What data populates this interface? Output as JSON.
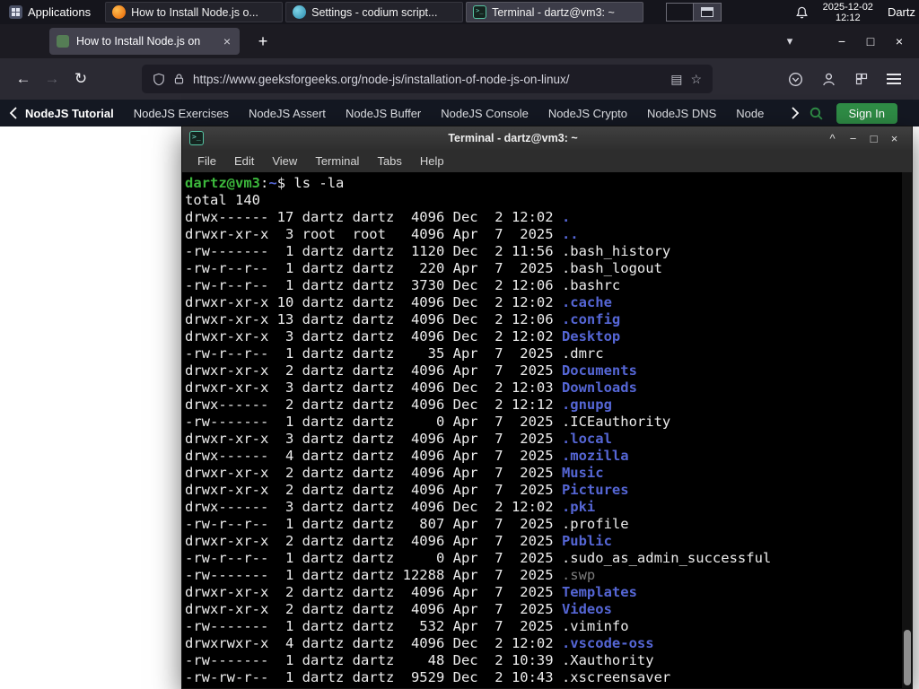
{
  "colors": {
    "gfg_green": "#2f8d46",
    "terminal_dir_blue": "#5566d5",
    "terminal_prompt_green": "#3cb83c",
    "terminal_dim": "#7d7d7d",
    "panel_bg": "#15151c",
    "firefox_toolbar": "#2b2a33"
  },
  "icons": {
    "back": "←",
    "forward": "→",
    "reload": "↻",
    "reader": "▤",
    "bookmark": "☆",
    "tab_list": "▾",
    "new_tab": "+",
    "tab_close": "×",
    "minimize": "−",
    "maximize": "□",
    "close": "×",
    "shade": "^"
  },
  "panel": {
    "applications_label": "Applications",
    "tasks": [
      {
        "label": "How to Install Node.js o...",
        "icon": "firefox",
        "cls": ""
      },
      {
        "label": "Settings - codium script...",
        "icon": "codium",
        "cls": ""
      },
      {
        "label": "Terminal - dartz@vm3: ~",
        "icon": "terminal",
        "cls": "active"
      }
    ],
    "clock_date": "2025-12-02",
    "clock_time": "12:12",
    "user_label": "Dartz"
  },
  "browser": {
    "tab_title": "How to Install Node.js on",
    "url": "https://www.geeksforgeeks.org/node-js/installation-of-node-js-on-linux/"
  },
  "site_nav": {
    "items": [
      {
        "label": "NodeJS Tutorial",
        "cls": "active"
      },
      {
        "label": "NodeJS Exercises",
        "cls": ""
      },
      {
        "label": "NodeJS Assert",
        "cls": ""
      },
      {
        "label": "NodeJS Buffer",
        "cls": ""
      },
      {
        "label": "NodeJS Console",
        "cls": ""
      },
      {
        "label": "NodeJS Crypto",
        "cls": ""
      },
      {
        "label": "NodeJS DNS",
        "cls": ""
      },
      {
        "label": "Node",
        "cls": ""
      }
    ],
    "signin_label": "Sign In"
  },
  "terminal": {
    "title": "Terminal - dartz@vm3: ~",
    "menu": [
      {
        "label": "File"
      },
      {
        "label": "Edit"
      },
      {
        "label": "View"
      },
      {
        "label": "Terminal"
      },
      {
        "label": "Tabs"
      },
      {
        "label": "Help"
      }
    ],
    "prompt": {
      "user_host": "dartz@vm3",
      "colon": ":",
      "path": "~",
      "dollar": "$",
      "command": " ls -la"
    },
    "total_line": "total 140",
    "lines": [
      {
        "pre": "drwx------ 17 dartz dartz  4096 Dec  2 12:02 ",
        "name": ".",
        "cls": "dir"
      },
      {
        "pre": "drwxr-xr-x  3 root  root   4096 Apr  7  2025 ",
        "name": "..",
        "cls": "dir"
      },
      {
        "pre": "-rw-------  1 dartz dartz  1120 Dec  2 11:56 ",
        "name": ".bash_history",
        "cls": "plain"
      },
      {
        "pre": "-rw-r--r--  1 dartz dartz   220 Apr  7  2025 ",
        "name": ".bash_logout",
        "cls": "plain"
      },
      {
        "pre": "-rw-r--r--  1 dartz dartz  3730 Dec  2 12:06 ",
        "name": ".bashrc",
        "cls": "plain"
      },
      {
        "pre": "drwxr-xr-x 10 dartz dartz  4096 Dec  2 12:02 ",
        "name": ".cache",
        "cls": "dir"
      },
      {
        "pre": "drwxr-xr-x 13 dartz dartz  4096 Dec  2 12:06 ",
        "name": ".config",
        "cls": "dir"
      },
      {
        "pre": "drwxr-xr-x  3 dartz dartz  4096 Dec  2 12:02 ",
        "name": "Desktop",
        "cls": "dir"
      },
      {
        "pre": "-rw-r--r--  1 dartz dartz    35 Apr  7  2025 ",
        "name": ".dmrc",
        "cls": "plain"
      },
      {
        "pre": "drwxr-xr-x  2 dartz dartz  4096 Apr  7  2025 ",
        "name": "Documents",
        "cls": "dir"
      },
      {
        "pre": "drwxr-xr-x  3 dartz dartz  4096 Dec  2 12:03 ",
        "name": "Downloads",
        "cls": "dir"
      },
      {
        "pre": "drwx------  2 dartz dartz  4096 Dec  2 12:12 ",
        "name": ".gnupg",
        "cls": "dir"
      },
      {
        "pre": "-rw-------  1 dartz dartz     0 Apr  7  2025 ",
        "name": ".ICEauthority",
        "cls": "plain"
      },
      {
        "pre": "drwxr-xr-x  3 dartz dartz  4096 Apr  7  2025 ",
        "name": ".local",
        "cls": "dir"
      },
      {
        "pre": "drwx------  4 dartz dartz  4096 Apr  7  2025 ",
        "name": ".mozilla",
        "cls": "dir"
      },
      {
        "pre": "drwxr-xr-x  2 dartz dartz  4096 Apr  7  2025 ",
        "name": "Music",
        "cls": "dir"
      },
      {
        "pre": "drwxr-xr-x  2 dartz dartz  4096 Apr  7  2025 ",
        "name": "Pictures",
        "cls": "dir"
      },
      {
        "pre": "drwx------  3 dartz dartz  4096 Dec  2 12:02 ",
        "name": ".pki",
        "cls": "dir"
      },
      {
        "pre": "-rw-r--r--  1 dartz dartz   807 Apr  7  2025 ",
        "name": ".profile",
        "cls": "plain"
      },
      {
        "pre": "drwxr-xr-x  2 dartz dartz  4096 Apr  7  2025 ",
        "name": "Public",
        "cls": "dir"
      },
      {
        "pre": "-rw-r--r--  1 dartz dartz     0 Apr  7  2025 ",
        "name": ".sudo_as_admin_successful",
        "cls": "plain"
      },
      {
        "pre": "-rw-------  1 dartz dartz 12288 Apr  7  2025 ",
        "name": ".swp",
        "cls": "dim"
      },
      {
        "pre": "drwxr-xr-x  2 dartz dartz  4096 Apr  7  2025 ",
        "name": "Templates",
        "cls": "dir"
      },
      {
        "pre": "drwxr-xr-x  2 dartz dartz  4096 Apr  7  2025 ",
        "name": "Videos",
        "cls": "dir"
      },
      {
        "pre": "-rw-------  1 dartz dartz   532 Apr  7  2025 ",
        "name": ".viminfo",
        "cls": "plain"
      },
      {
        "pre": "drwxrwxr-x  4 dartz dartz  4096 Dec  2 12:02 ",
        "name": ".vscode-oss",
        "cls": "dir"
      },
      {
        "pre": "-rw-------  1 dartz dartz    48 Dec  2 10:39 ",
        "name": ".Xauthority",
        "cls": "plain"
      },
      {
        "pre": "-rw-rw-r--  1 dartz dartz  9529 Dec  2 10:43 ",
        "name": ".xscreensaver",
        "cls": "plain"
      }
    ]
  }
}
